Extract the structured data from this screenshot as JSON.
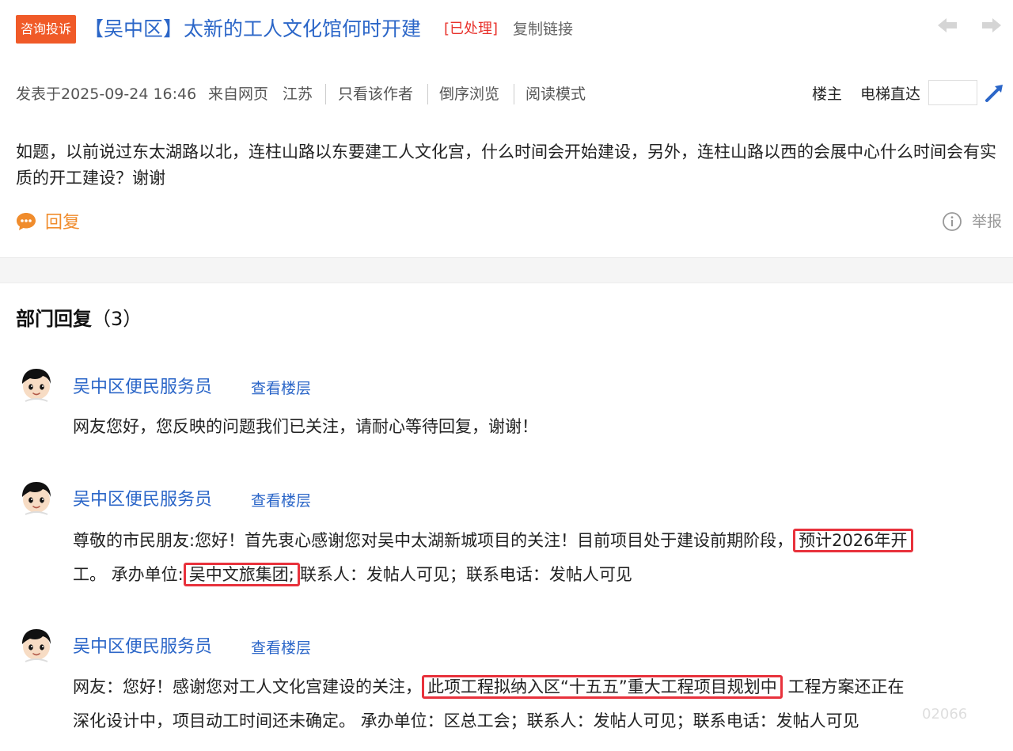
{
  "header": {
    "tag": "咨询投诉",
    "district": "【吴中区】",
    "title": "太新的工人文化馆何时开建",
    "status": "[已处理]",
    "copy_link": "复制链接",
    "prev_icon": "arrow-left-icon",
    "next_icon": "arrow-right-icon"
  },
  "meta": {
    "posted": "发表于2025-09-24 16:46",
    "source": "来自网页",
    "region": "江苏",
    "author_only": "只看该作者",
    "reverse": "倒序浏览",
    "read_mode": "阅读模式",
    "floor_owner": "楼主",
    "elevator": "电梯直达",
    "floor_input_value": ""
  },
  "post": {
    "body": "如题，以前说过东太湖路以北，连柱山路以东要建工人文化宫，什么时间会开始建设，另外，连柱山路以西的会展中心什么时间会有实质的开工建设？谢谢",
    "reply_label": "回复",
    "report_label": "举报"
  },
  "section": {
    "title": "部门回复",
    "count": "（3）"
  },
  "replies": [
    {
      "name": "吴中区便民服务员",
      "view_floor": "查看楼层",
      "line1": "网友您好，您反映的问题我们已关注，请耐心等待回复，谢谢！"
    },
    {
      "name": "吴中区便民服务员",
      "view_floor": "查看楼层",
      "line1_a": "尊敬的市民朋友:您好！首先衷心感谢您对吴中太湖新城项目的关注！目前项目处于建设前期阶段，",
      "line1_hl": "预计2026年开",
      "line2_a": "工。 承办单位:",
      "line2_hl": "吴中文旅集团;",
      "line2_b": "联系人：发帖人可见；联系电话：发帖人可见"
    },
    {
      "name": "吴中区便民服务员",
      "view_floor": "查看楼层",
      "line1_a": "网友：您好！感谢您对工人文化宫建设的关注，",
      "line1_hl": "此项工程拟纳入区“十五五”重大工程项目规划中",
      "line1_b": "工程方案还正在",
      "line2": "深化设计中，项目动工时间还未确定。 承办单位：区总工会；联系人：发帖人可见；联系电话：发帖人可见"
    }
  ],
  "watermark": "02066",
  "colors": {
    "accent_blue": "#2b66c8",
    "tag_orange": "#f05a28",
    "status_red": "#e8322c",
    "highlight_box": "#e8323c",
    "reply_orange": "#f08c2c"
  }
}
